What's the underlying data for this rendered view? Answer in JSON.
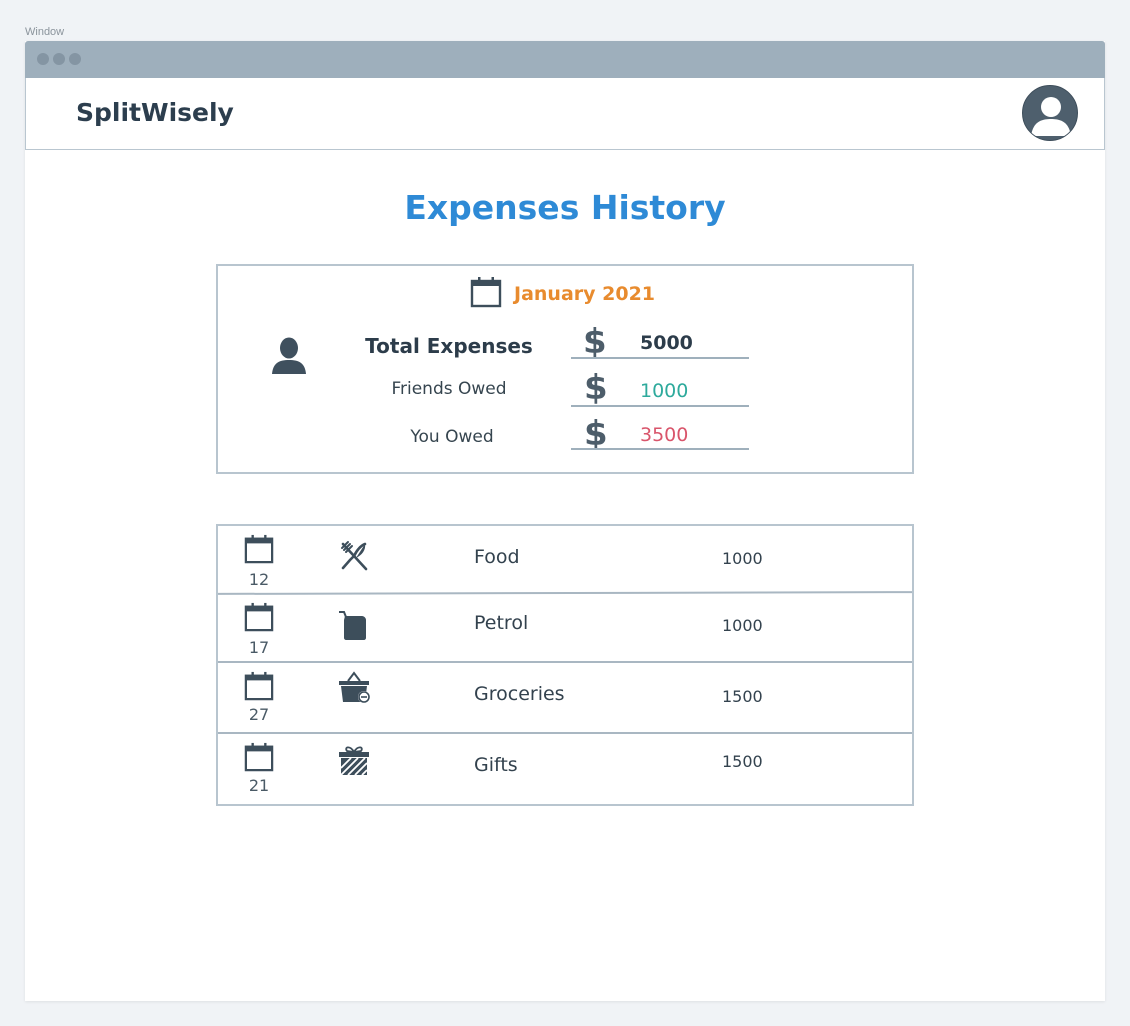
{
  "window": {
    "label": "Window"
  },
  "header": {
    "brand": "SplitWisely"
  },
  "main": {
    "title": "Expenses History",
    "summary": {
      "month": "January 2021",
      "rows": [
        {
          "label": "Total Expenses",
          "currency": "$",
          "amount": "5000"
        },
        {
          "label": "Friends Owed",
          "currency": "$",
          "amount": "1000"
        },
        {
          "label": "You Owed",
          "currency": "$",
          "amount": "3500"
        }
      ]
    },
    "expenses": [
      {
        "day": "12",
        "category": "Food",
        "icon": "fork-knife-icon",
        "amount": "1000"
      },
      {
        "day": "17",
        "category": "Petrol",
        "icon": "fuel-can-icon",
        "amount": "1000"
      },
      {
        "day": "27",
        "category": "Groceries",
        "icon": "basket-icon",
        "amount": "1500"
      },
      {
        "day": "21",
        "category": "Gifts",
        "icon": "gift-icon",
        "amount": "1500"
      }
    ]
  },
  "colors": {
    "title": "#2e8ad6",
    "month": "#e88b2e",
    "friends_owed": "#2eaa9c",
    "you_owed": "#d9556b",
    "titlebar": "#9eafbc"
  }
}
